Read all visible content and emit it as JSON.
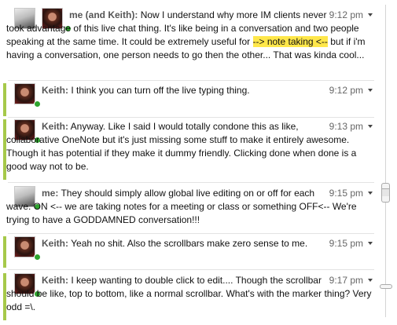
{
  "blips": [
    {
      "author": "me (and Keith):",
      "time": "9:12 pm",
      "text_before": "Now I understand why more IM clients never took advantage of this live chat thing.  It's like being in a conversation and two people speaking at the same time.  It could be extremely useful for ",
      "highlight": "--> note taking <--",
      "text_after": " but if i'm having a conversation, one person needs to go then the other...  That was kinda cool...",
      "unread": false
    },
    {
      "author": "Keith:",
      "time": "9:12 pm",
      "text": "I think you can turn off the live typing thing.",
      "unread": true
    },
    {
      "author": "Keith:",
      "time": "9:13 pm",
      "text": "Anyway. Like I said I would totally condone this as like, collaborative OneNote but it's just missing some stuff to make it entirely awesome. Though it has potential if they make it dummy friendly. Clicking done when done is a good way not to be.",
      "unread": true
    },
    {
      "author": "me:",
      "time": "9:15 pm",
      "text": "They should simply allow global live editing on or off for each wave.  ON <-- we are taking notes for a meeting or class or something  OFF<-- We're trying to have a GODDAMNED conversation!!!",
      "unread": false
    },
    {
      "author": "Keith:",
      "time": "9:15 pm",
      "text": "Yeah no shit. Also the scrollbars make zero sense to me.",
      "unread": true
    },
    {
      "author": "Keith:",
      "time": "9:17 pm",
      "text": "I keep wanting to double click to edit.... Though the scrollbar should be like, top to bottom, like a normal scrollbar. What's with the marker thing? Very odd =\\.",
      "unread": true
    }
  ],
  "icons": {
    "avatar_me": "avatar-me",
    "avatar_keith": "avatar-keith",
    "presence": "online-presence-dot",
    "menu": "blip-menu-caret",
    "scroll_up": "scroll-up-arrow",
    "scroll_down": "scroll-down-arrow",
    "scroll_marker": "scroll-position-marker"
  },
  "colors": {
    "unread_bar": "#a6c94a",
    "highlight": "#ffe74a",
    "presence_online": "#2fa52f",
    "author_text": "#555555",
    "time_text": "#666666"
  }
}
